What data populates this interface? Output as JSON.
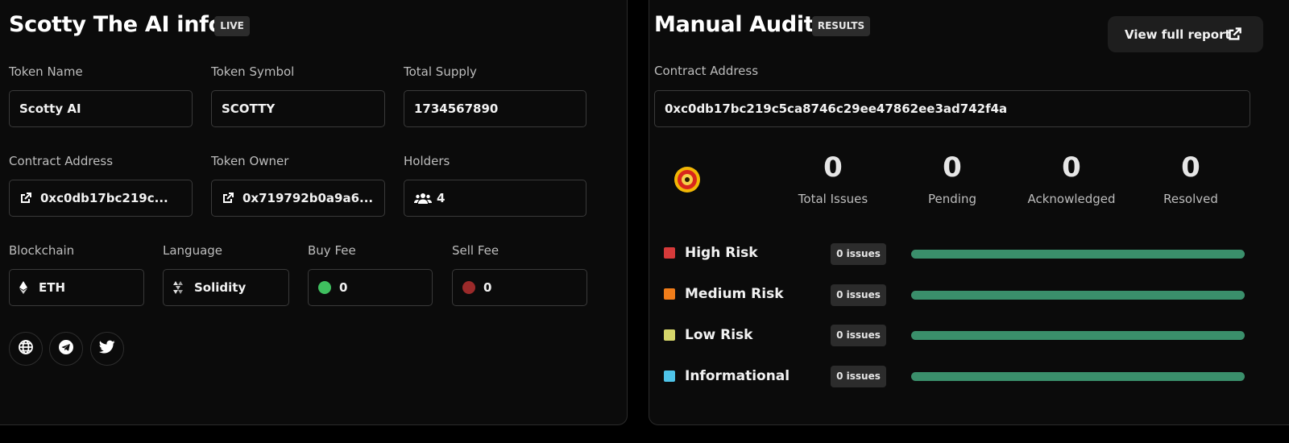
{
  "left": {
    "title": "Scotty The AI info",
    "status_tag": "LIVE",
    "fields": {
      "token_name": {
        "label": "Token Name",
        "value": "Scotty AI"
      },
      "token_symbol": {
        "label": "Token Symbol",
        "value": "SCOTTY"
      },
      "total_supply": {
        "label": "Total Supply",
        "value": "1734567890"
      },
      "contract_address": {
        "label": "Contract Address",
        "value": "0xc0db17bc219c...",
        "icon": "external-link-icon"
      },
      "token_owner": {
        "label": "Token Owner",
        "value": "0x719792b0a9a6...",
        "icon": "external-link-icon"
      },
      "holders": {
        "label": "Holders",
        "value": "4",
        "icon": "users-icon"
      },
      "blockchain": {
        "label": "Blockchain",
        "value": "ETH",
        "icon": "ethereum-icon"
      },
      "language": {
        "label": "Language",
        "value": "Solidity",
        "icon": "solidity-icon"
      },
      "buy_fee": {
        "label": "Buy Fee",
        "value": "0",
        "dot_color": "#3fbf5f"
      },
      "sell_fee": {
        "label": "Sell Fee",
        "value": "0",
        "dot_color": "#9b2a2a"
      }
    },
    "socials": [
      "globe-icon",
      "telegram-icon",
      "twitter-icon"
    ]
  },
  "right": {
    "title": "Manual Audit",
    "status_tag": "RESULTS",
    "report_button": "View full report",
    "contract_label": "Contract Address",
    "contract_value": "0xc0db17bc219c5ca8746c29ee47862ee3ad742f4a",
    "stats": [
      {
        "value": "0",
        "label": "Total Issues"
      },
      {
        "value": "0",
        "label": "Pending"
      },
      {
        "value": "0",
        "label": "Acknowledged"
      },
      {
        "value": "0",
        "label": "Resolved"
      }
    ],
    "risks": [
      {
        "label": "High Risk",
        "badge": "0 issues",
        "color": "#d63a3a",
        "progress": 1.0
      },
      {
        "label": "Medium Risk",
        "badge": "0 issues",
        "color": "#f07d1a",
        "progress": 1.0
      },
      {
        "label": "Low Risk",
        "badge": "0 issues",
        "color": "#d6d66a",
        "progress": 1.0
      },
      {
        "label": "Informational",
        "badge": "0 issues",
        "color": "#4ec3e8",
        "progress": 1.0
      }
    ],
    "bar_color": "#3a8f6b"
  }
}
